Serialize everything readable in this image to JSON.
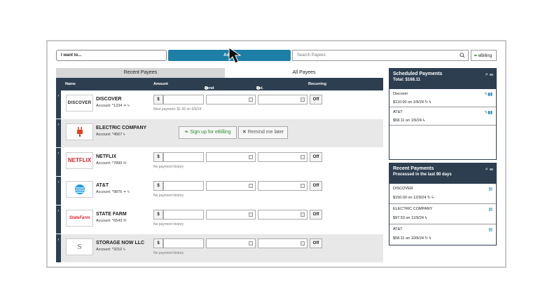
{
  "toolbar": {
    "i_want_to": "I want to...",
    "add_label": "Add a",
    "search_placeholder": "Search Payees",
    "ebilling_label": "eBilling"
  },
  "tabs": {
    "recent": "Recent Payees",
    "all": "All Payees"
  },
  "columns": {
    "name": "Name",
    "amount": "Amount",
    "send_on": "Send On",
    "est_delivery": "Est. Delivery",
    "recurring": "Recurring"
  },
  "payees": [
    {
      "logo": "DISCOVER",
      "name": "DISCOVER",
      "account": "Account: *1234",
      "note": "Next payment: $1.00 on 6/9/24",
      "dollar": "$",
      "recurring": "Off"
    },
    {
      "logo": "plug",
      "name": "ELECTRIC COMPANY",
      "account": "Account: *4567",
      "signup": "Sign up for eBilling",
      "remind": "Remind me later"
    },
    {
      "logo": "NETFLIX",
      "name": "NETFLIX",
      "account": "Account: *7890",
      "note": "No payment history",
      "dollar": "$",
      "recurring": "Off"
    },
    {
      "logo": "AT&T",
      "name": "AT&T",
      "account": "Account: *9876",
      "note": "No payment history",
      "dollar": "$",
      "recurring": "Off"
    },
    {
      "logo": "StateFarm",
      "name": "STATE FARM",
      "account": "Account: *6543",
      "note": "No payment history",
      "dollar": "$",
      "recurring": "Off"
    },
    {
      "logo": "S",
      "name": "STORAGE NOW LLC",
      "account": "Account: *3210",
      "note": "No payment history",
      "dollar": "$",
      "recurring": "Off"
    }
  ],
  "scheduled": {
    "title": "Scheduled Payments",
    "total": "Total: $168.11",
    "items": [
      {
        "name": "Discover",
        "value": "$110.00 on 1/9/24"
      },
      {
        "name": "AT&T",
        "value": "$58.11 on 1/9/24"
      }
    ]
  },
  "recent": {
    "title": "Recent Payments",
    "subtitle": "Processed in the last 90 days",
    "items": [
      {
        "name": "DISCOVER",
        "value": "$150.00 on 12/9/24"
      },
      {
        "name": "ELECTRIC COMPANY",
        "value": "$97.53 on 11/9/24"
      },
      {
        "name": "AT&T",
        "value": "$58.11 on 10/9/24"
      }
    ]
  },
  "colors": {
    "navy": "#2d3e50",
    "accent": "#1d7fa6",
    "green": "#2e8b2e"
  }
}
